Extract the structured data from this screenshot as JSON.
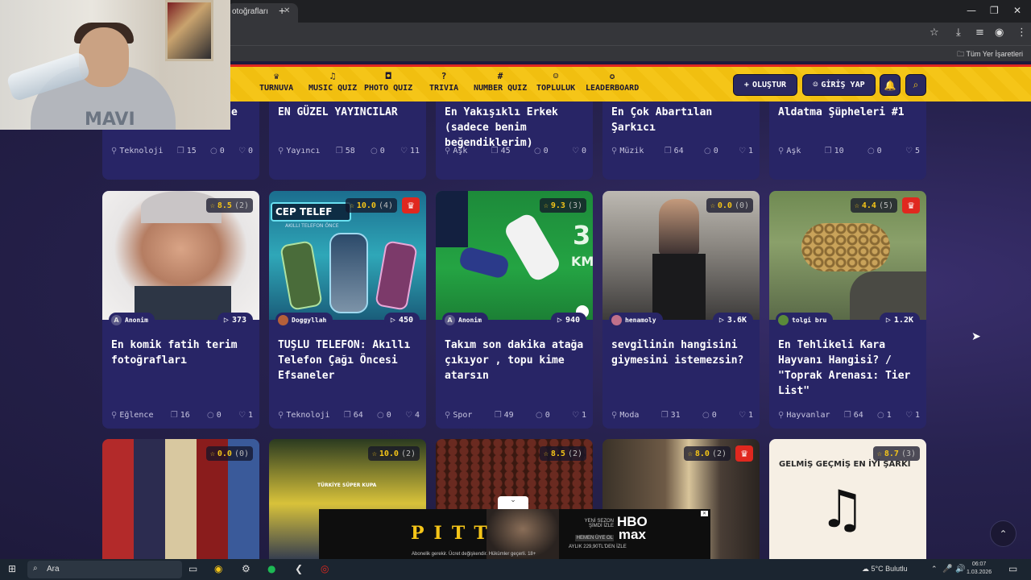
{
  "browser": {
    "tab_title": "otoğrafları",
    "bookmark_all": "Tüm Yer İşaretleri"
  },
  "nav": {
    "items": [
      "TURNUVA",
      "MUSIC QUIZ",
      "PHOTO QUIZ",
      "TRIVIA",
      "NUMBER QUIZ",
      "TOPLULUK",
      "LEADERBOARD"
    ],
    "create": "OLUŞTUR",
    "login": "GİRİŞ YAP"
  },
  "row1": [
    {
      "title": "e",
      "category": "Teknoloji",
      "items": "15",
      "comments": "0",
      "likes": "0"
    },
    {
      "title": "EN GÜZEL YAYINCILAR",
      "category": "Yayıncı",
      "items": "58",
      "comments": "0",
      "likes": "11"
    },
    {
      "title": "En Yakışıklı Erkek (sadece benim beğendiklerim)",
      "category": "Aşk",
      "items": "45",
      "comments": "0",
      "likes": "0"
    },
    {
      "title": "En Çok Abartılan Şarkıcı",
      "category": "Müzik",
      "items": "64",
      "comments": "0",
      "likes": "1"
    },
    {
      "title": "Aldatma Şüpheleri #1",
      "category": "Aşk",
      "items": "10",
      "comments": "0",
      "likes": "5"
    }
  ],
  "row2": [
    {
      "rating": "8.5",
      "count": "(2)",
      "author": "Anonim",
      "avatar": "A",
      "plays": "373",
      "title": "En komik fatih terim fotoğrafları",
      "category": "Eğlence",
      "items": "16",
      "comments": "0",
      "likes": "1"
    },
    {
      "rating": "10.0",
      "count": "(4)",
      "author": "Doggyllah",
      "avatar": "",
      "plays": "450",
      "title": "TUŞLU TELEFON: Akıllı Telefon Çağı Öncesi Efsaneler",
      "category": "Teknoloji",
      "items": "64",
      "comments": "0",
      "likes": "4"
    },
    {
      "rating": "9.3",
      "count": "(3)",
      "author": "Anonim",
      "avatar": "A",
      "plays": "940",
      "title": "Takım son dakika atağa çıkıyor , topu kime atarsın",
      "category": "Spor",
      "items": "49",
      "comments": "0",
      "likes": "1"
    },
    {
      "rating": "0.0",
      "count": "(0)",
      "author": "henamoly",
      "avatar": "",
      "plays": "3.6K",
      "title": "sevgilinin hangisini giymesini istemezsin?",
      "category": "Moda",
      "items": "31",
      "comments": "0",
      "likes": "1"
    },
    {
      "rating": "4.4",
      "count": "(5)",
      "author": "tolgi bru",
      "avatar": "",
      "plays": "1.2K",
      "title": "En Tehlikeli Kara Hayvanı Hangisi? / \"Toprak Arenası: Tier List\"",
      "category": "Hayvanlar",
      "items": "64",
      "comments": "1",
      "likes": "1"
    }
  ],
  "row3": [
    {
      "rating": "0.0",
      "count": "(0)"
    },
    {
      "rating": "10.0",
      "count": "(2)"
    },
    {
      "rating": "8.5",
      "count": "(2)"
    },
    {
      "rating": "8.0",
      "count": "(2)"
    },
    {
      "rating": "8.7",
      "count": "(3)",
      "thumb_text": "GELMİŞ GEÇMİŞ EN İYİ ŞARKI"
    }
  ],
  "thumb_texts": {
    "phone": "CEP TELEF",
    "phone_sub": "AKILLI TELEFON ÖNCE",
    "km": "3",
    "km2": "KM",
    "trophy": "TÜRKİYE SÜPER KUPA"
  },
  "ad": {
    "title": "PITT",
    "hbo": "HBO",
    "max": "max",
    "new": "YENİ SEZON ŞİMDİ İZLE",
    "member": "HEMEN ÜYE OL",
    "price": "AYLIK 229,90TL'DEN İZLE",
    "footer": "Abonelik gerekir. Ücret değişkendir. Hükümler geçerli. 18+"
  },
  "taskbar": {
    "search": "Ara",
    "weather": "5°C  Bulutlu",
    "time": "06:07",
    "date": "1.03.2026"
  }
}
